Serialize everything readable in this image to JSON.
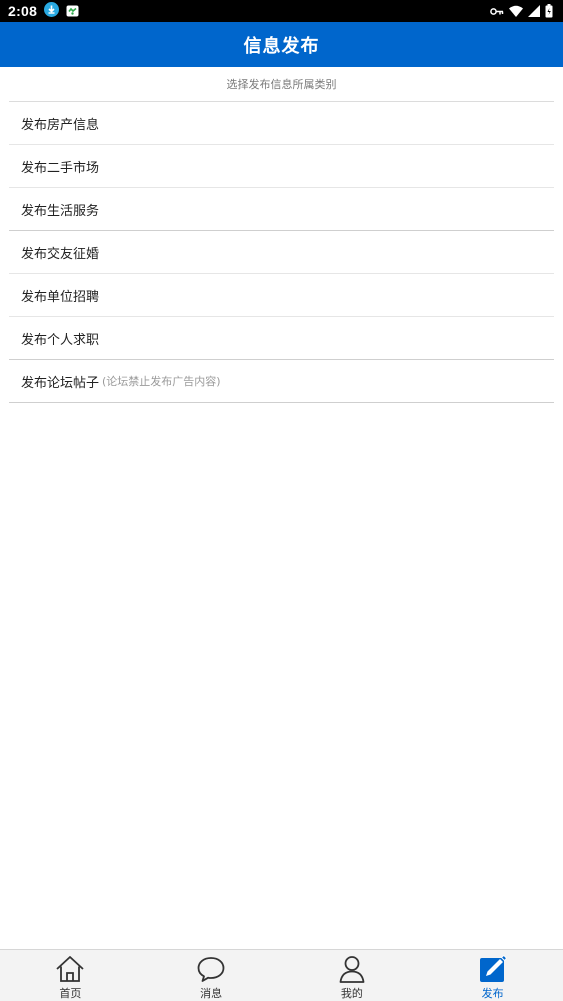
{
  "status_bar": {
    "time": "2:08",
    "icons": [
      "download-icon",
      "app-notification-icon",
      "vpn-key-icon",
      "wifi-icon",
      "cellular-signal-icon",
      "battery-icon"
    ]
  },
  "header": {
    "title": "信息发布"
  },
  "hint": "选择发布信息所属类别",
  "categories": [
    {
      "label": "发布房产信息"
    },
    {
      "label": "发布二手市场"
    },
    {
      "label": "发布生活服务"
    },
    {
      "label": "发布交友征婚"
    },
    {
      "label": "发布单位招聘"
    },
    {
      "label": "发布个人求职"
    },
    {
      "label": "发布论坛帖子",
      "note": "(论坛禁止发布广告内容)"
    }
  ],
  "tab_bar": {
    "tabs": [
      {
        "label": "首页",
        "icon": "home-icon"
      },
      {
        "label": "消息",
        "icon": "chat-bubble-icon"
      },
      {
        "label": "我的",
        "icon": "user-icon"
      },
      {
        "label": "发布",
        "icon": "edit-icon",
        "active": true
      }
    ]
  },
  "colors": {
    "primary": "#0066cc",
    "status_bar": "#000000",
    "tab_bar_bg": "#f3f3f3",
    "download_badge": "#29a9e1"
  }
}
